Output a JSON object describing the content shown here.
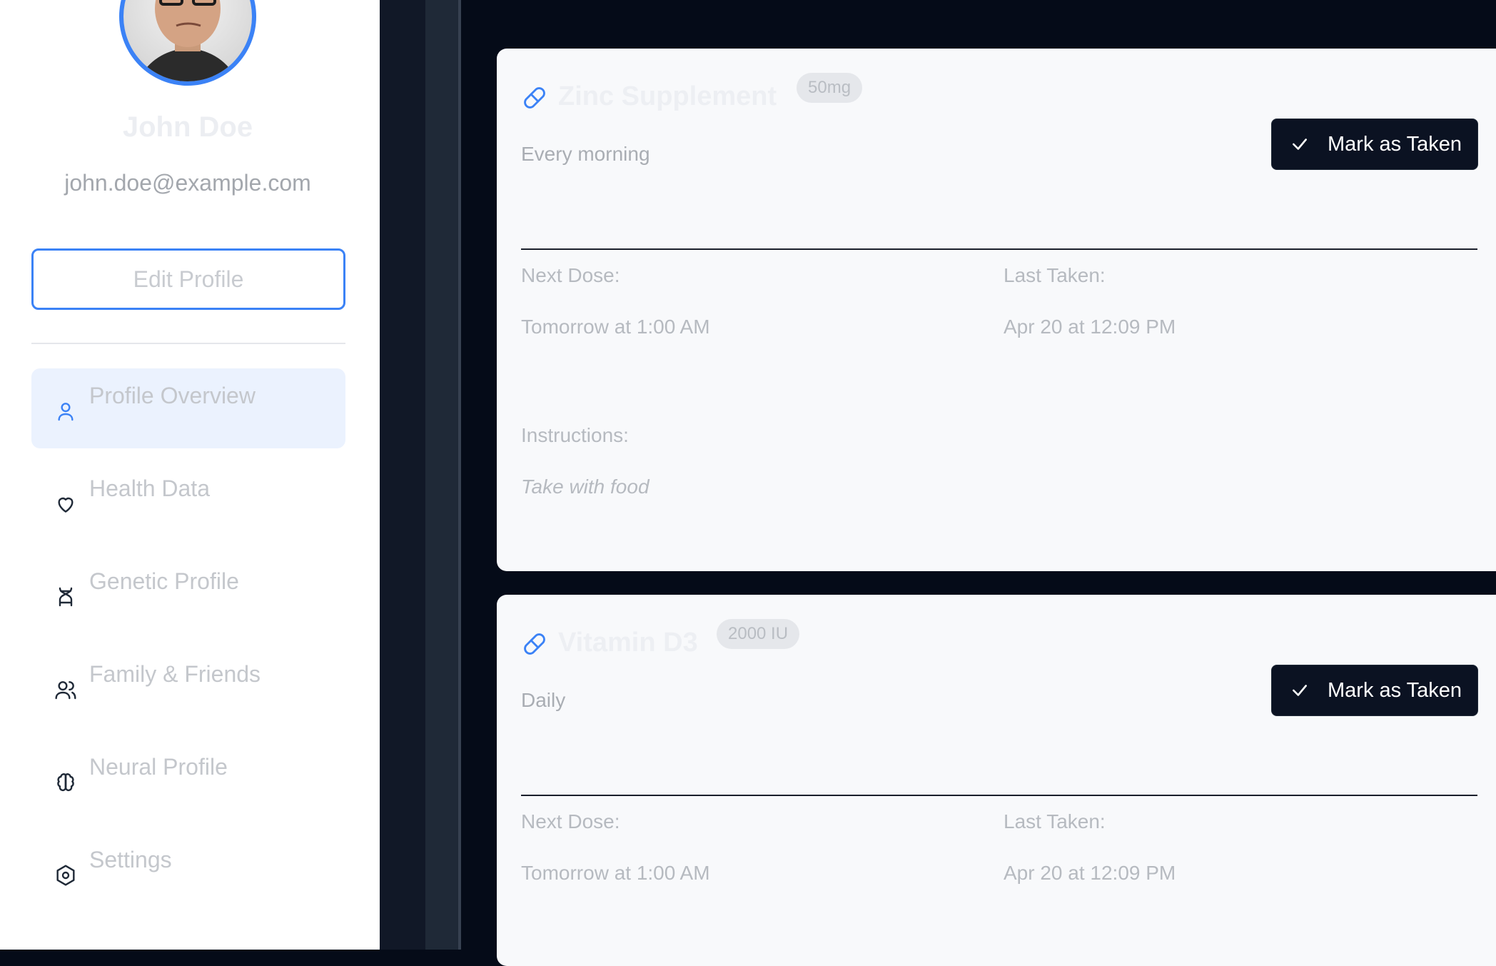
{
  "profile": {
    "name": "John Doe",
    "email": "john.doe@example.com",
    "edit_label": "Edit Profile"
  },
  "nav": {
    "items": [
      {
        "label": "Profile Overview",
        "icon": "user-icon",
        "active": true
      },
      {
        "label": "Health Data",
        "icon": "heart-icon",
        "active": false
      },
      {
        "label": "Genetic Profile",
        "icon": "dna-icon",
        "active": false
      },
      {
        "label": "Family & Friends",
        "icon": "users-icon",
        "active": false
      },
      {
        "label": "Neural Profile",
        "icon": "brain-icon",
        "active": false
      },
      {
        "label": "Settings",
        "icon": "settings-icon",
        "active": false
      }
    ]
  },
  "medications": [
    {
      "name": "Zinc Supplement",
      "dose": "50mg",
      "schedule": "Every morning",
      "mark_label": "Mark as Taken",
      "next_dose_label": "Next Dose:",
      "next_dose": "Tomorrow at 1:00 AM",
      "last_taken_label": "Last Taken:",
      "last_taken": "Apr 20 at 12:09 PM",
      "instructions_label": "Instructions:",
      "instructions": "Take with food"
    },
    {
      "name": "Vitamin D3",
      "dose": "2000 IU",
      "schedule": "Daily",
      "mark_label": "Mark as Taken",
      "next_dose_label": "Next Dose:",
      "next_dose": "Tomorrow at 1:00 AM",
      "last_taken_label": "Last Taken:",
      "last_taken": "Apr 20 at 12:09 PM"
    }
  ],
  "colors": {
    "accent": "#3b82f6",
    "dark": "#050b18",
    "card": "#f8f9fb",
    "button": "#0b1222"
  }
}
